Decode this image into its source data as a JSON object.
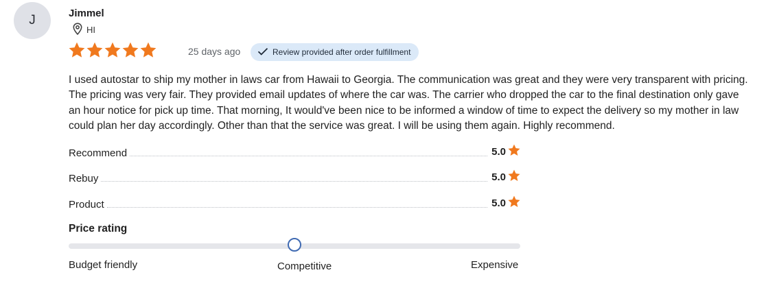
{
  "reviewer": {
    "initial": "J",
    "name": "Jimmel",
    "location": "HI"
  },
  "review": {
    "stars": 5,
    "date": "25 days ago",
    "badge": "Review provided after order fulfillment",
    "text": "I used autostar to ship my mother in laws car from Hawaii to Georgia. The communication was great and they were very transparent with pricing. The pricing was very fair. They provided email updates of where the car was. The carrier who dropped the car to the final destination only gave an hour notice for pick up time. That morning, It would've been nice to be informed a window of time to expect the delivery so my mother in law could plan her day accordingly. Other than that the service was great. I will be using them again. Highly recommend."
  },
  "ratings": [
    {
      "label": "Recommend",
      "value": "5.0"
    },
    {
      "label": "Rebuy",
      "value": "5.0"
    },
    {
      "label": "Product",
      "value": "5.0"
    }
  ],
  "price_rating": {
    "title": "Price rating",
    "labels": [
      "Budget friendly",
      "Competitive",
      "Expensive"
    ],
    "value_fraction": 0.5
  },
  "colors": {
    "star": "#f0791e",
    "avatar_bg": "#dfe1e7",
    "badge_bg": "#dbe9f8",
    "slider_knob": "#3f6ab2"
  },
  "icons": {
    "location": "map-pin-icon",
    "badge": "checkmark-icon",
    "rating": "star-icon"
  }
}
